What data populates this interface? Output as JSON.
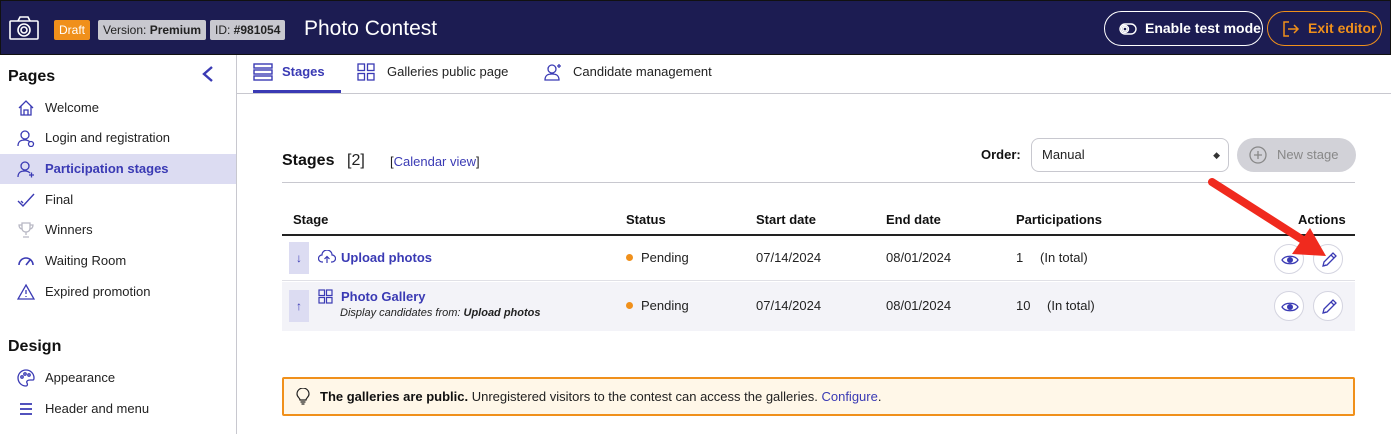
{
  "header": {
    "badge_draft": "Draft",
    "version_label": "Version: ",
    "version_value": "Premium",
    "id_label": "ID: ",
    "id_value": "#981054",
    "title": "Photo Contest",
    "test_mode_label": "Enable test mode",
    "exit_label": "Exit editor"
  },
  "sidebar": {
    "pages_heading": "Pages",
    "design_heading": "Design",
    "items": [
      {
        "label": "Welcome",
        "icon": "home-icon"
      },
      {
        "label": "Login and registration",
        "icon": "user-login-icon"
      },
      {
        "label": "Participation stages",
        "icon": "user-stages-icon",
        "active": true
      },
      {
        "label": "Final",
        "icon": "check-icon"
      },
      {
        "label": "Winners",
        "icon": "trophy-icon"
      },
      {
        "label": "Waiting Room",
        "icon": "gauge-icon"
      },
      {
        "label": "Expired promotion",
        "icon": "warning-icon"
      }
    ],
    "design_items": [
      {
        "label": "Appearance",
        "icon": "palette-icon"
      },
      {
        "label": "Header and menu",
        "icon": "menu-icon"
      }
    ]
  },
  "tabs": [
    {
      "label": "Stages",
      "icon": "list-icon",
      "active": true
    },
    {
      "label": "Galleries public page",
      "icon": "grid-icon"
    },
    {
      "label": "Candidate management",
      "icon": "candidates-icon"
    }
  ],
  "main": {
    "title": "Stages",
    "count": "[2]",
    "calendar_open": "[",
    "calendar_link": "Calendar view",
    "calendar_close": "]",
    "order_label": "Order:",
    "order_value": "Manual",
    "new_stage_label": "New stage",
    "columns": [
      "Stage",
      "Status",
      "Start date",
      "End date",
      "Participations",
      "Actions"
    ],
    "rows": [
      {
        "move": "↓",
        "name": "Upload photos",
        "icon": "cloud-upload-icon",
        "status": "Pending",
        "start": "07/14/2024",
        "end": "08/01/2024",
        "participations": "1",
        "participations_note": "(In total)"
      },
      {
        "move": "↑",
        "name": "Photo Gallery",
        "icon": "grid-icon",
        "sub_prefix": "Display candidates from: ",
        "sub_value": "Upload photos",
        "status": "Pending",
        "start": "07/14/2024",
        "end": "08/01/2024",
        "participations": "10",
        "participations_note": "(In total)"
      }
    ],
    "banner": {
      "bold": "The galleries are public.",
      "text": " Unregistered visitors to the contest can access the galleries. ",
      "link": "Configure",
      "end": "."
    }
  },
  "colors": {
    "header_bg": "#1c1c52",
    "accent": "#3a3ab4",
    "orange": "#f0901b",
    "arrow": "#f02a1e"
  }
}
